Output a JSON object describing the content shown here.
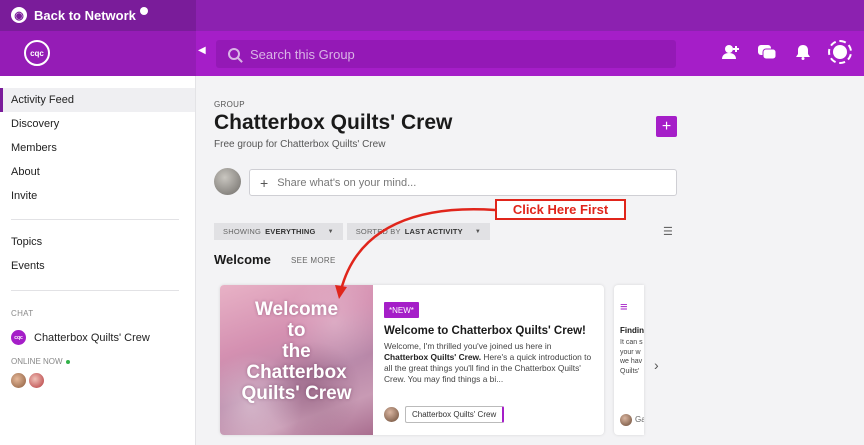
{
  "topbar": {
    "back_label": "Back to Network"
  },
  "header": {
    "logo_text": "cqc",
    "search_placeholder": "Search this Group"
  },
  "sidebar": {
    "items": [
      {
        "label": "Activity Feed"
      },
      {
        "label": "Discovery"
      },
      {
        "label": "Members"
      },
      {
        "label": "About"
      },
      {
        "label": "Invite"
      },
      {
        "label": "Topics"
      },
      {
        "label": "Events"
      }
    ],
    "chat_heading": "CHAT",
    "chat_item_label": "Chatterbox Quilts' Crew",
    "chat_logo_text": "cqc",
    "online_label": "ONLINE NOW"
  },
  "group": {
    "eyebrow": "GROUP",
    "title": "Chatterbox Quilts' Crew",
    "subtitle": "Free group for Chatterbox Quilts' Crew",
    "add_label": "+"
  },
  "composer": {
    "placeholder": "Share what's on your mind..."
  },
  "filters": {
    "showing_prefix": "SHOWING",
    "showing_value": "EVERYTHING",
    "sorted_prefix": "SORTED BY",
    "sorted_value": "LAST ACTIVITY"
  },
  "section": {
    "title": "Welcome",
    "see_more": "SEE MORE"
  },
  "card": {
    "image_text": "Welcome\nto\nthe\nChatterbox\nQuilts' Crew",
    "badge": "*NEW*",
    "title": "Welcome to Chatterbox Quilts' Crew!",
    "body_lead": "Welcome, I'm thrilled you've joined us here in",
    "body_bold": "Chatterbox Quilts' Crew.",
    "body_rest": "Here's a quick introduction to all the great things you'll find in the Chatterbox Quilts' Crew. You may find things a bi...",
    "author_tag": "Chatterbox Quilts' Crew"
  },
  "card2": {
    "title": "Findin",
    "body": "It can s your w we hav Quilts'",
    "author": "Ga"
  },
  "annotation": {
    "label": "Click Here First",
    "color": "#e0251b"
  },
  "colors": {
    "brand": "#a51ec8",
    "brand_dark": "#7a1c9a"
  }
}
